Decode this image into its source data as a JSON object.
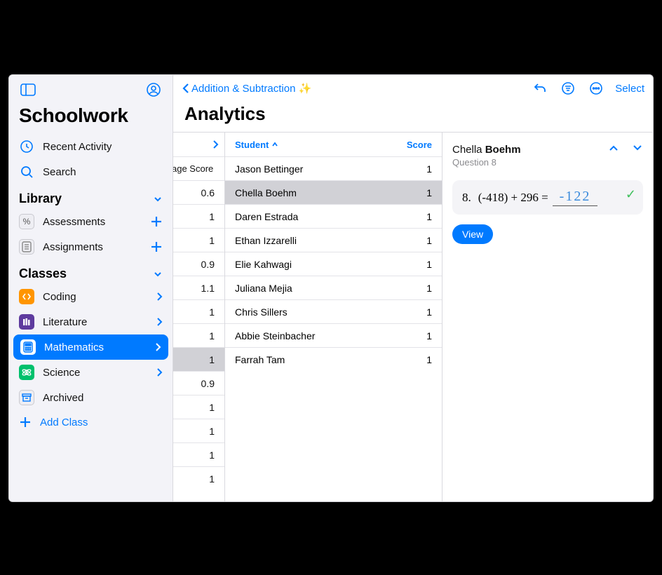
{
  "app": {
    "title": "Schoolwork"
  },
  "sidebar": {
    "recent": "Recent Activity",
    "search": "Search",
    "library_label": "Library",
    "assessments": "Assessments",
    "assignments": "Assignments",
    "classes_label": "Classes",
    "classes": [
      {
        "label": "Coding"
      },
      {
        "label": "Literature"
      },
      {
        "label": "Mathematics"
      },
      {
        "label": "Science"
      },
      {
        "label": "Archived"
      }
    ],
    "add_class": "Add Class"
  },
  "header": {
    "back": "Addition & Subtraction ✨",
    "title": "Analytics",
    "select": "Select"
  },
  "summary": {
    "header": "age Score",
    "rows": [
      0.6,
      1,
      1,
      0.9,
      1.1,
      1,
      1,
      1,
      0.9,
      1,
      1,
      1,
      1
    ],
    "selected_index": 7
  },
  "students": {
    "header_student": "Student",
    "header_score": "Score",
    "rows": [
      {
        "name": "Jason Bettinger",
        "score": 1
      },
      {
        "name": "Chella Boehm",
        "score": 1
      },
      {
        "name": "Daren Estrada",
        "score": 1
      },
      {
        "name": "Ethan Izzarelli",
        "score": 1
      },
      {
        "name": "Elie Kahwagi",
        "score": 1
      },
      {
        "name": "Juliana Mejia",
        "score": 1
      },
      {
        "name": "Chris Sillers",
        "score": 1
      },
      {
        "name": "Abbie Steinbacher",
        "score": 1
      },
      {
        "name": "Farrah Tam",
        "score": 1
      }
    ],
    "selected_index": 1
  },
  "detail": {
    "first": "Chella",
    "last": "Boehm",
    "question": "Question 8",
    "problem_index": "8.",
    "problem": "(-418) + 296 =",
    "answer": "-122",
    "view": "View"
  }
}
